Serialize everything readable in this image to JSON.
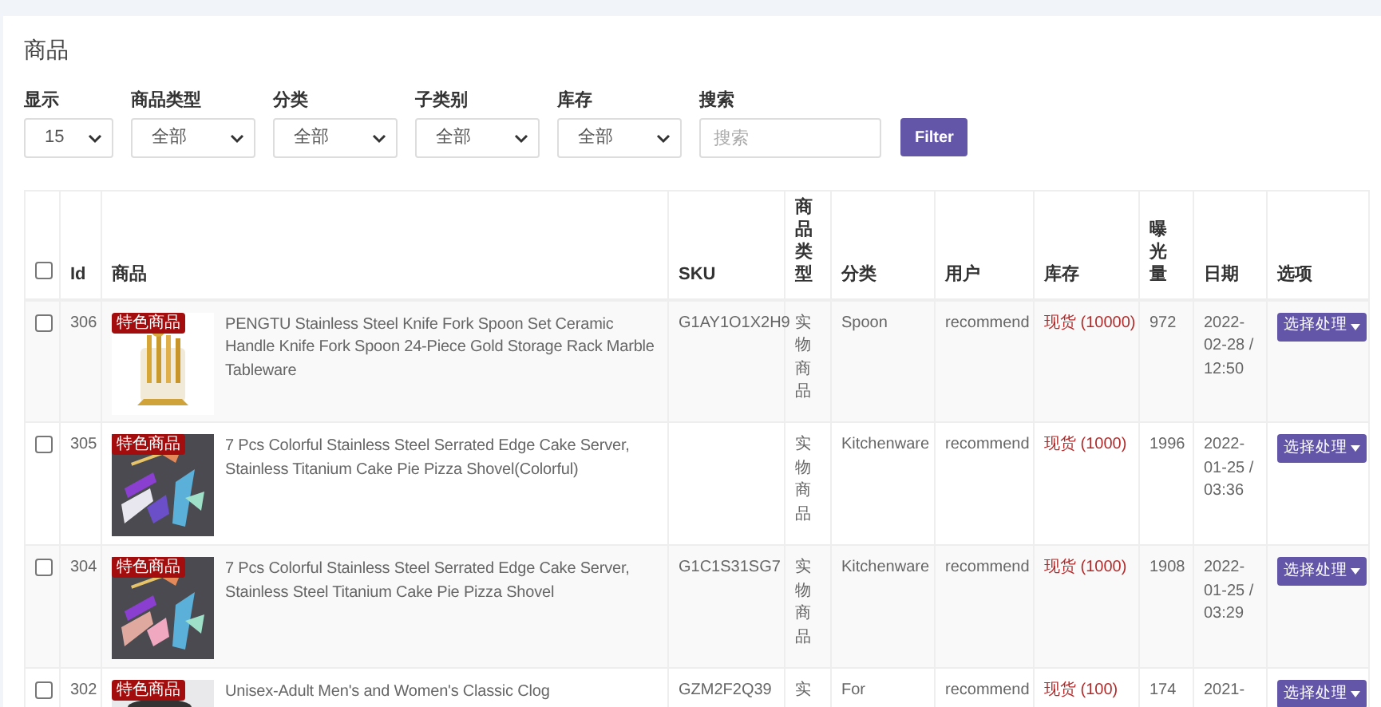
{
  "page_title": "商品",
  "filters": [
    {
      "kind": "select",
      "label": "显示",
      "value": "15"
    },
    {
      "kind": "select",
      "label": "商品类型",
      "value": "全部"
    },
    {
      "kind": "select",
      "label": "分类",
      "value": "全部"
    },
    {
      "kind": "select",
      "label": "子类别",
      "value": "全部"
    },
    {
      "kind": "select",
      "label": "库存",
      "value": "全部"
    },
    {
      "kind": "search",
      "label": "搜索",
      "placeholder": "搜索"
    }
  ],
  "filter_button": "Filter",
  "table": {
    "select_all_checked": false,
    "columns": [
      "Id",
      "商品",
      "SKU",
      "商品类型",
      "分类",
      "用户",
      "库存",
      "曝光量",
      "日期",
      "选项"
    ],
    "rows": [
      {
        "checked": false,
        "id": "306",
        "badge": "特色商品",
        "name": "PENGTU Stainless Steel Knife Fork Spoon Set Ceramic Handle Knife Fork Spoon 24-Piece Gold Storage Rack Marble Tableware",
        "sku": "G1AY1O1X2H9",
        "type": "实物商品",
        "category": "Spoon",
        "user": "recommend",
        "stock": "现货 (10000)",
        "views": "972",
        "date": "2022-02-28 / 12:50",
        "action": "选择处理"
      },
      {
        "checked": false,
        "id": "305",
        "badge": "特色商品",
        "name": "7 Pcs Colorful Stainless Steel Serrated Edge Cake Server, Stainless Titanium Cake Pie Pizza Shovel(Colorful)",
        "type": "实物商品",
        "category": "Kitchenware",
        "user": "recommend",
        "stock": "现货 (1000)",
        "views": "1996",
        "date": "2022-01-25 / 03:36",
        "action": "选择处理"
      },
      {
        "checked": false,
        "id": "304",
        "badge": "特色商品",
        "name": "7 Pcs Colorful Stainless Steel Serrated Edge Cake Server, Stainless Steel Titanium Cake Pie Pizza Shovel",
        "sku": "G1C1S31SG7",
        "type": "实物商品",
        "category": "Kitchenware",
        "user": "recommend",
        "stock": "现货 (1000)",
        "views": "1908",
        "date": "2022-01-25 / 03:29",
        "action": "选择处理"
      },
      {
        "checked": false,
        "id": "302",
        "badge": "特色商品",
        "name": "Unisex-Adult Men's and Women's Classic Clog",
        "sku": "GZM2F2Q39",
        "type": "实",
        "category": "For",
        "user": "recommend",
        "stock": "现货 (100)",
        "views": "174",
        "date": "2021-",
        "action": "选择处理"
      }
    ]
  }
}
